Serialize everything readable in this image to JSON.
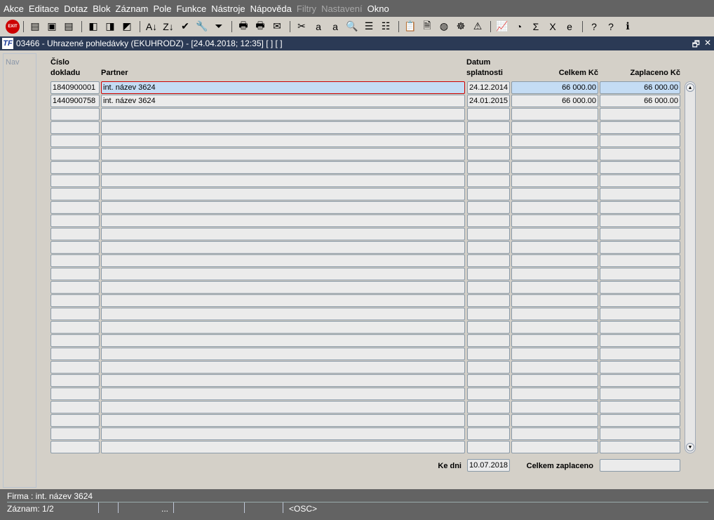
{
  "menu": [
    {
      "label": "Akce",
      "enabled": true
    },
    {
      "label": "Editace",
      "enabled": true
    },
    {
      "label": "Dotaz",
      "enabled": true
    },
    {
      "label": "Blok",
      "enabled": true
    },
    {
      "label": "Záznam",
      "enabled": true
    },
    {
      "label": "Pole",
      "enabled": true
    },
    {
      "label": "Funkce",
      "enabled": true
    },
    {
      "label": "Nástroje",
      "enabled": true
    },
    {
      "label": "Nápověda",
      "enabled": true
    },
    {
      "label": "Filtry",
      "enabled": false
    },
    {
      "label": "Nastavení",
      "enabled": false
    },
    {
      "label": "Okno",
      "enabled": true
    }
  ],
  "toolbar": {
    "exit_label": "EXIT",
    "icons": [
      "insert-record-icon",
      "save-record-icon",
      "delete-record-icon",
      "query-icon",
      "execute-query-icon",
      "cancel-query-icon",
      "sort-asc-icon",
      "sort-desc-icon",
      "check-icon",
      "wrench-icon",
      "filter-icon",
      "print-icon",
      "print-setup-icon",
      "mail-icon",
      "cut-icon",
      "copy-icon",
      "paste-icon",
      "search-icon",
      "list-icon",
      "columns-icon",
      "clipboard-icon",
      "document-icon",
      "globe-icon",
      "helm-icon",
      "warning-icon",
      "chart-icon",
      "clock-icon",
      "sum-icon",
      "excel-icon",
      "ie-icon",
      "help-context-icon",
      "help-icon",
      "info-icon"
    ],
    "glyphs": [
      "▤",
      "▣",
      "▤",
      "◧",
      "◨",
      "◩",
      "A↓",
      "Z↓",
      "✔",
      "🔧",
      "⏷",
      "🖶",
      "🖶",
      "✉",
      "✂",
      "a",
      "a",
      "🔍",
      "☰",
      "☷",
      "📋",
      "🗎",
      "◍",
      "☸",
      "⚠",
      "📈",
      "◔",
      "Σ",
      "X",
      "e",
      "?",
      "?",
      "ℹ"
    ]
  },
  "window": {
    "title": "03466 - Uhrazené pohledávky (EKUHRODZ) - [24.04.2018; 12:35]  [ ] [ ]",
    "logo": "TF",
    "restore": "🗗",
    "close": "✕"
  },
  "nav": {
    "label": "Nav"
  },
  "table": {
    "headers": {
      "doc": "Číslo\ndokladu",
      "partner": "Partner",
      "date": "Datum\nsplatnosti",
      "total": "Celkem Kč",
      "paid": "Zaplaceno Kč"
    },
    "rows": [
      {
        "doc": "1840900001",
        "partner": "int. název 3624",
        "date": "24.12.2014",
        "total": "66 000.00",
        "paid": "66 000.00"
      },
      {
        "doc": "1440900758",
        "partner": "int. název 3624",
        "date": "24.01.2015",
        "total": "66 000.00",
        "paid": "66 000.00"
      }
    ],
    "empty_rows": 26
  },
  "footer": {
    "ke_dni_label": "Ke dni",
    "ke_dni_value": "10.07.2018",
    "total_paid_label": "Celkem zaplaceno",
    "total_paid_value": ""
  },
  "status": {
    "firma": "Firma : int. název 3624",
    "zaznam": "Záznam: 1/2",
    "ellipsis": "...",
    "mode": "<OSC>"
  }
}
